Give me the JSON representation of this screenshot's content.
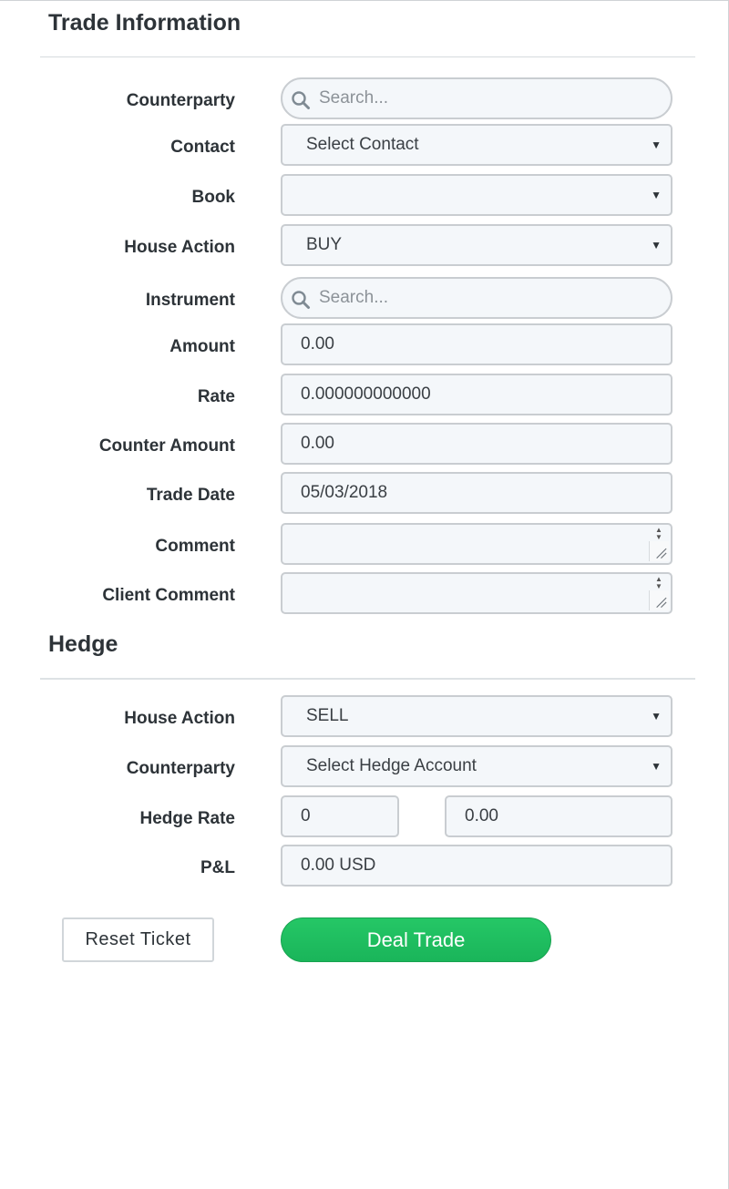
{
  "trade_info": {
    "title": "Trade Information",
    "counterparty": {
      "label": "Counterparty",
      "placeholder": "Search..."
    },
    "contact": {
      "label": "Contact",
      "value": "Select Contact"
    },
    "book": {
      "label": "Book",
      "value": ""
    },
    "house_action": {
      "label": "House Action",
      "value": "BUY"
    },
    "instrument": {
      "label": "Instrument",
      "placeholder": "Search..."
    },
    "amount": {
      "label": "Amount",
      "value": "0.00"
    },
    "rate": {
      "label": "Rate",
      "value": "0.000000000000"
    },
    "counter_amount": {
      "label": "Counter Amount",
      "value": "0.00"
    },
    "trade_date": {
      "label": "Trade Date",
      "value": "05/03/2018"
    },
    "comment": {
      "label": "Comment",
      "value": ""
    },
    "client_comment": {
      "label": "Client Comment",
      "value": ""
    }
  },
  "hedge": {
    "title": "Hedge",
    "house_action": {
      "label": "House Action",
      "value": "SELL"
    },
    "counterparty": {
      "label": "Counterparty",
      "value": "Select Hedge Account"
    },
    "hedge_rate": {
      "label": "Hedge Rate",
      "value_a": "0",
      "value_b": "0.00"
    },
    "pnl": {
      "label": "P&L",
      "value": "0.00 USD"
    }
  },
  "actions": {
    "reset_label": "Reset Ticket",
    "deal_label": "Deal Trade"
  },
  "colors": {
    "deal_button": "#22c063",
    "field_bg": "#f4f7fa",
    "text": "#2d3338"
  },
  "icons": {
    "search": "search-icon",
    "caret": "chevron-down-icon",
    "spinner": "spinner-icon",
    "resize": "resize-handle-icon"
  }
}
